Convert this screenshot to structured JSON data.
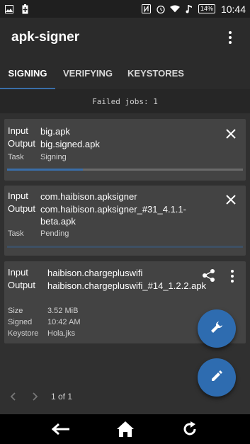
{
  "status_bar": {
    "time": "10:44",
    "battery": "14%",
    "icons": [
      "image-icon",
      "battery-saver-icon",
      "nfc-icon",
      "alarm-icon",
      "wifi-icon",
      "music-icon",
      "battery-icon"
    ]
  },
  "app_bar": {
    "title": "apk-signer",
    "overflow_icon": "more-vert-icon"
  },
  "tabs": [
    {
      "label": "SIGNING",
      "active": true
    },
    {
      "label": "VERIFYING",
      "active": false
    },
    {
      "label": "KEYSTORES",
      "active": false
    }
  ],
  "failed_jobs": "Failed jobs: 1",
  "jobs": [
    {
      "input_label": "Input",
      "input": "big.apk",
      "output_label": "Output",
      "output": "big.signed.apk",
      "task_label": "Task",
      "task": "Signing",
      "progress": 0.32
    },
    {
      "input_label": "Input",
      "input": "com.haibison.apksigner",
      "output_label": "Output",
      "output": "com.haibison.apksigner_#31_4.1.1-beta.apk",
      "task_label": "Task",
      "task": "Pending",
      "progress": 0
    },
    {
      "input_label": "Input",
      "input": "haibison.chargepluswifi",
      "output_label": "Output",
      "output": "haibison.chargepluswifi_#14_1.2.2.apk",
      "size_label": "Size",
      "size": "3.52 MiB",
      "signed_label": "Signed",
      "signed": "10:42 AM",
      "keystore_label": "Keystore",
      "keystore": "Hola.jks"
    }
  ],
  "pager": {
    "text": "1 of 1"
  },
  "colors": {
    "accent": "#2e6cb0",
    "card": "#434343",
    "background": "#303030"
  }
}
